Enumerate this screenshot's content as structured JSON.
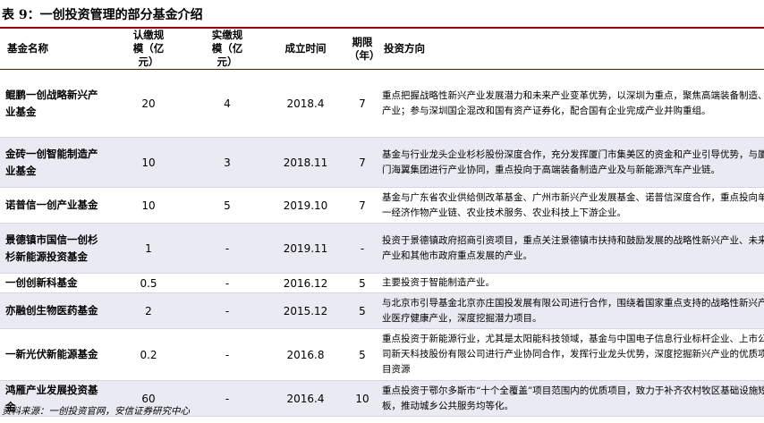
{
  "caption": "表 9：一创投资管理的部分基金介绍",
  "headers": {
    "name": "基金名称",
    "subscribed": "认缴规模（亿元）",
    "paid": "实缴规模（亿元）",
    "established": "成立时间",
    "term": "期限（年）",
    "direction": "投资方向"
  },
  "rows": [
    {
      "name": "鲲鹏一创战略新兴产业基金",
      "subscribed": "20",
      "paid": "4",
      "established": "2018.4",
      "term": "7",
      "direction": "重点把握战略性新兴产业发展潜力和未来产业变革优势，以深圳为重点，聚焦高端装备制造、大消费、生物医药、TMT（科技、媒体及电信）等国家政策支持的战略性新兴产业和未来产业；参与深圳国企混改和国有资产证券化，配合国有企业完成产业并购重组。"
    },
    {
      "name": "金砖一创智能制造产业基金",
      "subscribed": "10",
      "paid": "3",
      "established": "2018.11",
      "term": "7",
      "direction": "基金与行业龙头企业杉杉股份深度合作，充分发挥厦门市集美区的资金和产业引导优势，与厦门海翼集团进行产业协同，重点投向于高端装备制造产业及与新能源汽车产业链。"
    },
    {
      "name": "诺普信一创产业基金",
      "subscribed": "10",
      "paid": "5",
      "established": "2019.10",
      "term": "7",
      "direction": "基金与广东省农业供给侧改革基金、广州市新兴产业发展基金、诺普信深度合作，重点投向单一经济作物产业链、农业技术服务、农业科技上下游企业。"
    },
    {
      "name": "景德镇市国信一创杉杉新能源投资基金",
      "subscribed": "1",
      "paid": "-",
      "established": "2019.11",
      "term": "-",
      "direction": "投资于景德镇政府招商引资项目，重点关注景德镇市扶持和鼓励发展的战略性新兴产业、未来产业和其他市政府重点发展的产业。"
    },
    {
      "name": "一创创新科基金",
      "subscribed": "0.5",
      "paid": "-",
      "established": "2016.12",
      "term": "5",
      "direction": "主要投资于智能制造产业。"
    },
    {
      "name": "亦融创生物医药基金",
      "subscribed": "2",
      "paid": "-",
      "established": "2015.12",
      "term": "5",
      "direction": "与北京市引导基金北京亦庄国投发展有限公司进行合作，围绕着国家重点支持的战略性新兴产业医疗健康产业，深度挖掘潜力项目。"
    },
    {
      "name": "一新光伏新能源基金",
      "subscribed": "0.2",
      "paid": "-",
      "established": "2016.8",
      "term": "5",
      "direction": "重点投资于新能源行业，尤其是太阳能科技领域，基金与中国电子信息行业标杆企业、上市公司新天科技股份有限公司进行产业协同合作，发挥行业龙头优势，深度挖掘新兴产业的优质项目资源"
    },
    {
      "name": "鸿雁产业发展投资基金",
      "subscribed": "60",
      "paid": "-",
      "established": "2016.4",
      "term": "10",
      "direction": "重点投资于鄂尔多斯市“十个全覆盖”项目范围内的优质项目，致力于补齐农村牧区基础设施短板，推动城乡公共服务均等化。"
    }
  ],
  "source": "资料来源：一创投资官网，安信证券研究中心"
}
